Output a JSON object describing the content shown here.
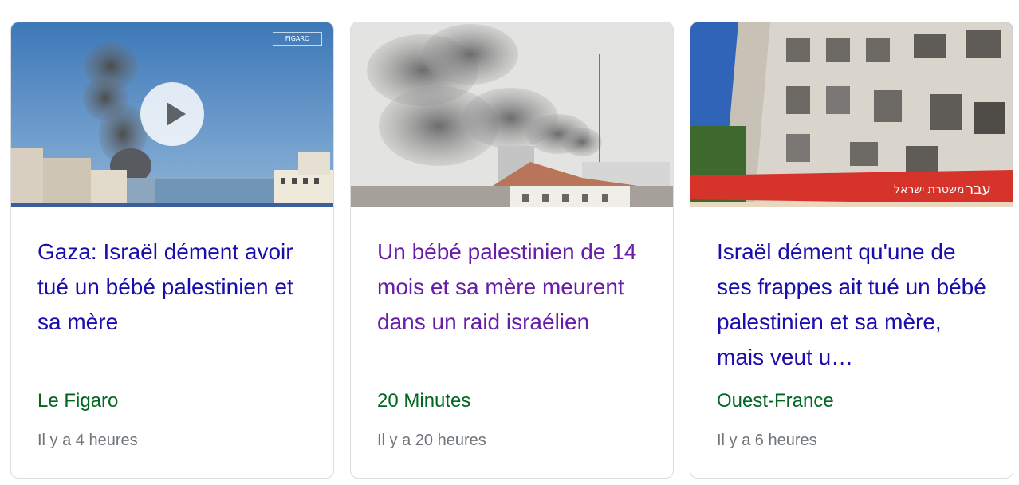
{
  "cards": [
    {
      "headline": "Gaza: Israël dément avoir tué un bébé palestinien et sa mère",
      "source": "Le Figaro",
      "time": "Il y a 4 heures",
      "has_video": true,
      "watermark": "FIGARO",
      "visited": false,
      "play_icon": "play-icon"
    },
    {
      "headline": "Un bébé palestinien de 14 mois et sa mère meurent dans un raid israélien",
      "source": "20 Minutes",
      "time": "Il y a 20 heures",
      "has_video": false,
      "visited": true
    },
    {
      "headline": "Israël dément qu'une de ses frappes ait tué un bébé palestinien et sa mère, mais veut u…",
      "source": "Ouest-France",
      "time": "Il y a 6 heures",
      "has_video": false,
      "visited": false
    }
  ],
  "colors": {
    "headline_link": "#1a0dab",
    "headline_visited": "#681da8",
    "source": "#006621",
    "time": "#70757a",
    "border": "#dadce0"
  }
}
